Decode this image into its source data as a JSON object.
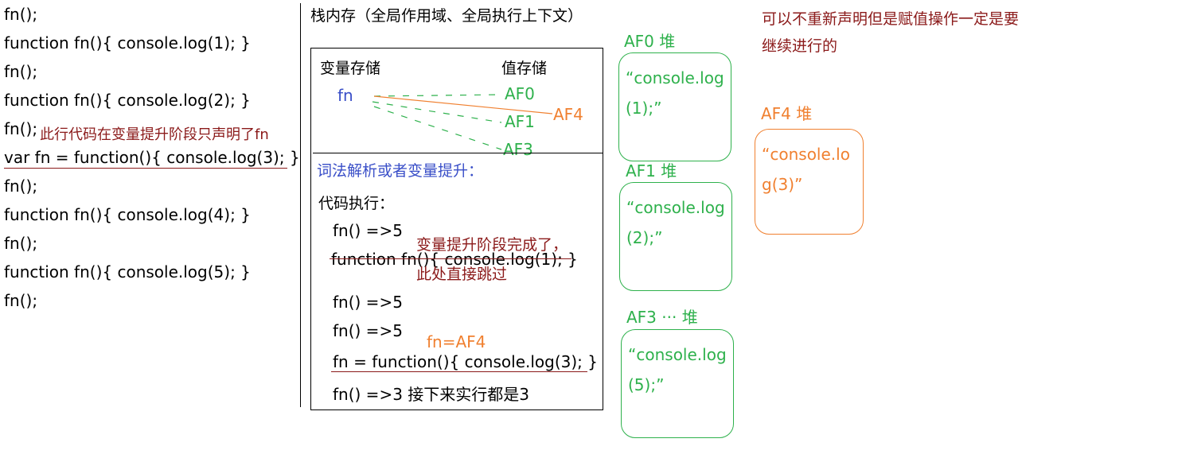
{
  "code_lines": [
    "fn();",
    "function fn(){ console.log(1); }",
    "fn();",
    "function fn(){ console.log(2); }",
    "fn();",
    "var fn = function(){ console.log(3); }",
    "fn();",
    "function fn(){ console.log(4); }",
    "fn();",
    "function fn(){ console.log(5); }",
    "fn();"
  ],
  "annotation_hoist_only_declared": "此行代码在变量提升阶段只声明了fn",
  "stack": {
    "title": "栈内存（全局作用域、全局执行上下文）",
    "var_storage_label": "变量存储",
    "value_storage_label": "值存储",
    "var_fn": "fn",
    "addresses": [
      "AF0",
      "AF1",
      "AF3"
    ],
    "new_address": "AF4",
    "lexical_label": "词法解析或者变量提升：",
    "exec_label": "代码执行：",
    "exec_lines": {
      "l1": "fn()     =>5",
      "l2": "function fn(){ console.log(1); }",
      "l3": "fn()    =>5",
      "l4": "fn()    =>5",
      "l5": "fn = function(){ console.log(3); }",
      "l6": "fn()    =>3      接下来实行都是3"
    },
    "skip_note_1": "变量提升阶段完成了，",
    "skip_note_2": "此处直接跳过",
    "assign_note": "fn=AF4"
  },
  "heaps": [
    {
      "label": "AF0  堆",
      "content": "“console.log(1);”"
    },
    {
      "label": "AF1  堆",
      "content": "“console.log(2);”"
    },
    {
      "label": "AF3 ···  堆",
      "content": "“console.log(5);”"
    },
    {
      "label": "AF4  堆",
      "content": "“console.log(3)”"
    }
  ],
  "top_note": [
    "可以不重新声明但是赋值操作一定是要",
    "继续进行的"
  ],
  "colors": {
    "green": "#2eb14c",
    "orange": "#f08030",
    "dark_red": "#8b1a1a",
    "blue": "#3a4fc8"
  }
}
